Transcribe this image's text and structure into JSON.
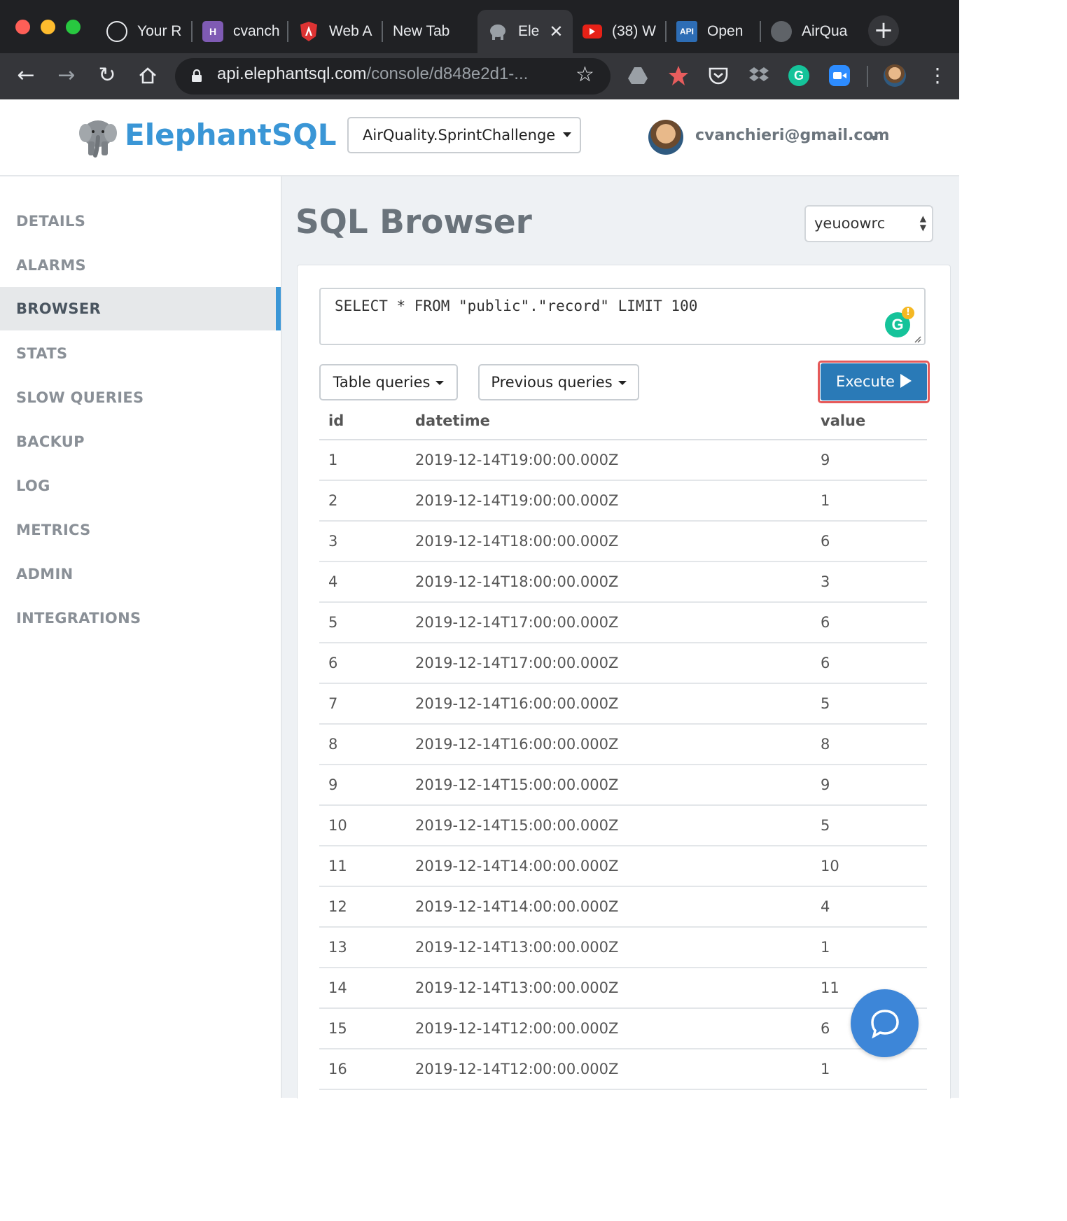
{
  "browser": {
    "tabs": [
      {
        "label": "Your R",
        "favicon": "github-icon"
      },
      {
        "label": "cvanch",
        "favicon": "heroku-icon"
      },
      {
        "label": "Web A",
        "favicon": "shield-icon"
      },
      {
        "label": "New Tab",
        "favicon": ""
      },
      {
        "label": "Ele",
        "favicon": "elephant-icon",
        "active": true
      },
      {
        "label": "(38) W",
        "favicon": "youtube-icon"
      },
      {
        "label": "Open",
        "favicon": "api-icon"
      },
      {
        "label": "AirQua",
        "favicon": "globe-icon"
      }
    ],
    "url_host": "api.elephantsql.com",
    "url_path": "/console/d848e2d1-..."
  },
  "header": {
    "logo": "ElephantSQL",
    "instance": "AirQuality.SprintChallenge",
    "user_email": "cvanchieri@gmail.com"
  },
  "sidebar": {
    "items": [
      {
        "label": "DETAILS"
      },
      {
        "label": "ALARMS"
      },
      {
        "label": "BROWSER",
        "active": true
      },
      {
        "label": "STATS"
      },
      {
        "label": "SLOW QUERIES"
      },
      {
        "label": "BACKUP"
      },
      {
        "label": "LOG"
      },
      {
        "label": "METRICS"
      },
      {
        "label": "ADMIN"
      },
      {
        "label": "INTEGRATIONS"
      }
    ]
  },
  "main": {
    "title": "SQL Browser",
    "database": "yeuoowrc",
    "query": "SELECT * FROM \"public\".\"record\" LIMIT 100",
    "table_queries_label": "Table queries",
    "previous_queries_label": "Previous queries",
    "execute_label": "Execute",
    "columns": [
      "id",
      "datetime",
      "value"
    ],
    "rows": [
      [
        "1",
        "2019-12-14T19:00:00.000Z",
        "9"
      ],
      [
        "2",
        "2019-12-14T19:00:00.000Z",
        "1"
      ],
      [
        "3",
        "2019-12-14T18:00:00.000Z",
        "6"
      ],
      [
        "4",
        "2019-12-14T18:00:00.000Z",
        "3"
      ],
      [
        "5",
        "2019-12-14T17:00:00.000Z",
        "6"
      ],
      [
        "6",
        "2019-12-14T17:00:00.000Z",
        "6"
      ],
      [
        "7",
        "2019-12-14T16:00:00.000Z",
        "5"
      ],
      [
        "8",
        "2019-12-14T16:00:00.000Z",
        "8"
      ],
      [
        "9",
        "2019-12-14T15:00:00.000Z",
        "9"
      ],
      [
        "10",
        "2019-12-14T15:00:00.000Z",
        "5"
      ],
      [
        "11",
        "2019-12-14T14:00:00.000Z",
        "10"
      ],
      [
        "12",
        "2019-12-14T14:00:00.000Z",
        "4"
      ],
      [
        "13",
        "2019-12-14T13:00:00.000Z",
        "1"
      ],
      [
        "14",
        "2019-12-14T13:00:00.000Z",
        "11"
      ],
      [
        "15",
        "2019-12-14T12:00:00.000Z",
        "6"
      ],
      [
        "16",
        "2019-12-14T12:00:00.000Z",
        "1"
      ]
    ]
  },
  "colors": {
    "accent": "#3a96d6",
    "execute": "#2a7ab7",
    "execute_highlight": "#e55a5a"
  }
}
